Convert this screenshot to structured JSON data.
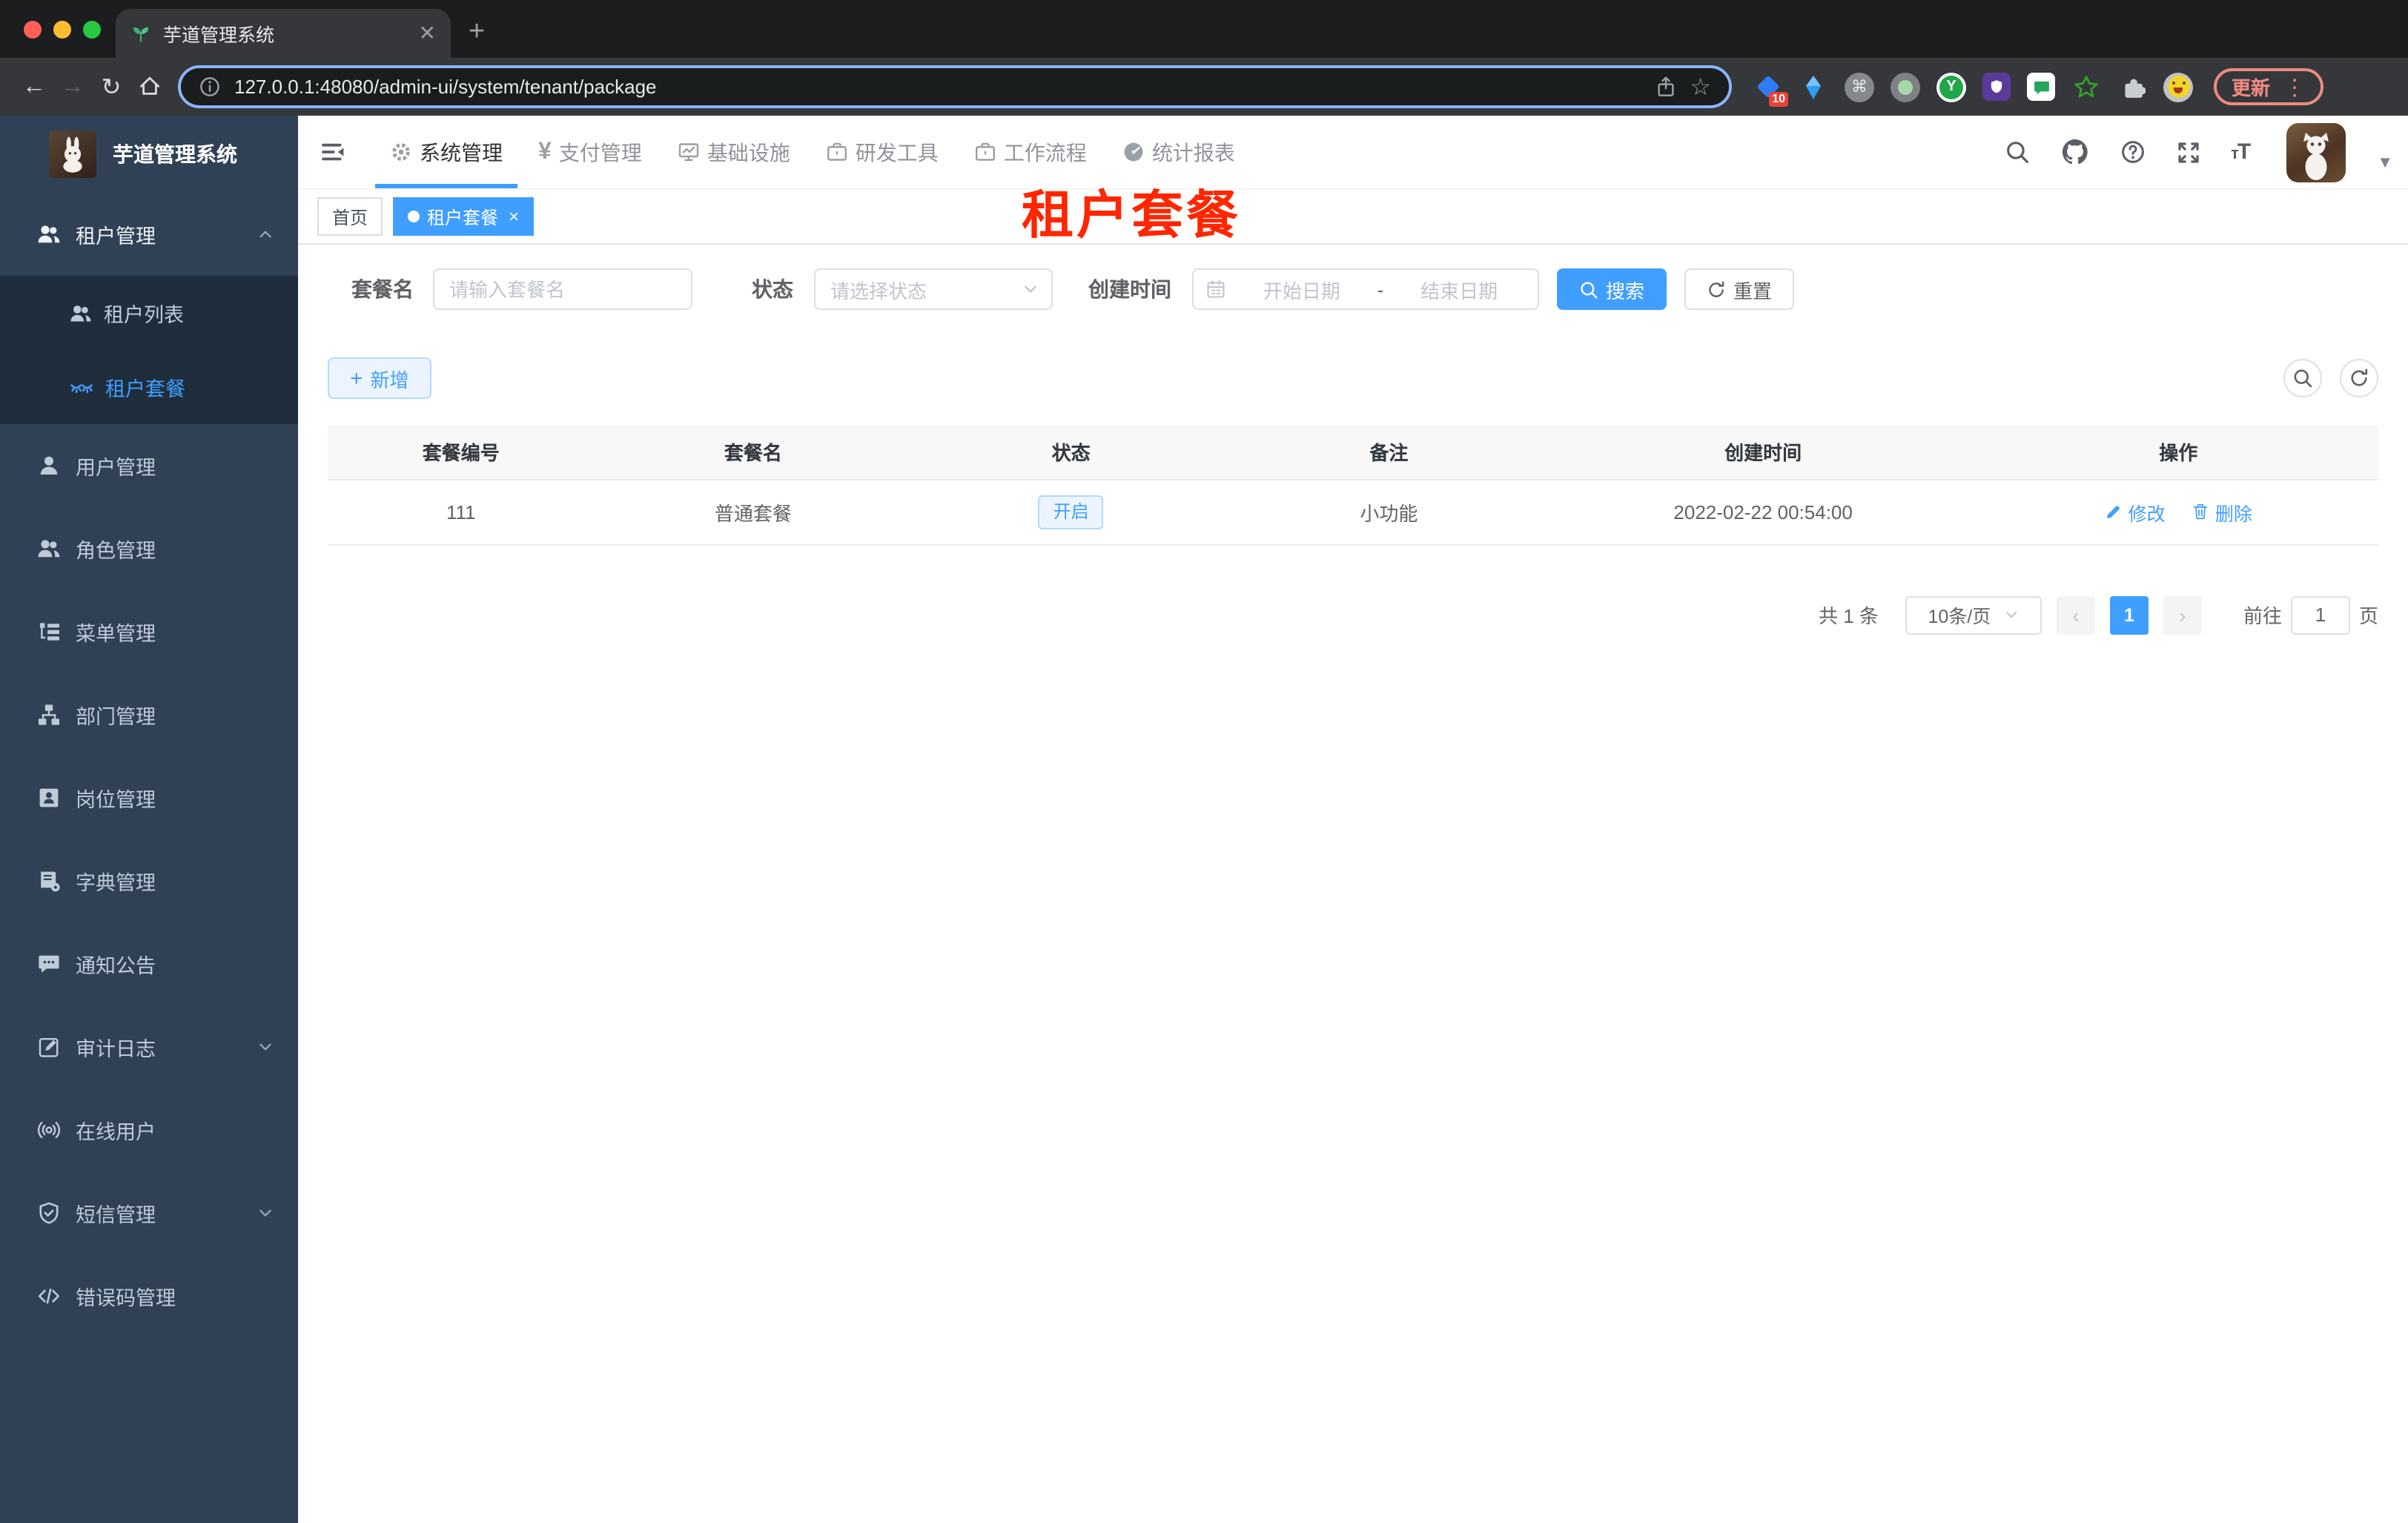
{
  "browser": {
    "tab": {
      "title": "芋道管理系统",
      "favicon": "seedling-icon",
      "close_icon": "close-icon"
    },
    "new_tab_icon": "plus-icon",
    "url": "127.0.0.1:48080/admin-ui/system/tenant/package",
    "toolbar_icons": [
      "back-icon",
      "forward-icon",
      "reload-icon",
      "home-icon",
      "info-icon",
      "share-icon",
      "star-icon"
    ],
    "extension_icons": [
      "diamond-extension-icon",
      "kite-extension-icon",
      "command-extension-icon",
      "record-extension-icon",
      "y-extension-icon",
      "shield-extension-icon",
      "chat-extension-icon",
      "star-extension-icon",
      "puzzle-extensions-icon",
      "emoji-avatar-icon"
    ],
    "extensions_badge": "10",
    "update_label": "更新",
    "menu_icon": "kebab-menu-icon"
  },
  "app": {
    "logo_title": "芋道管理系统",
    "overlay_text": "租户套餐",
    "top_nav": {
      "items": [
        {
          "label": "系统管理",
          "icon": "gear-icon",
          "active": true
        },
        {
          "label": "支付管理",
          "icon": "yen-icon",
          "active": false
        },
        {
          "label": "基础设施",
          "icon": "monitor-icon",
          "active": false
        },
        {
          "label": "研发工具",
          "icon": "toolbox-icon",
          "active": false
        },
        {
          "label": "工作流程",
          "icon": "workflow-icon",
          "active": false
        },
        {
          "label": "统计报表",
          "icon": "dashboard-icon",
          "active": false
        }
      ]
    },
    "header_icons": [
      "search-icon",
      "github-icon",
      "question-icon",
      "fullscreen-icon",
      "font-size-icon",
      "avatar",
      "caret-down-icon"
    ],
    "sidebar": {
      "items": [
        {
          "label": "租户管理",
          "icon": "users-icon",
          "state": "expanded"
        },
        {
          "label": "租户列表",
          "icon": "tenant-list-icon",
          "child": true
        },
        {
          "label": "租户套餐",
          "icon": "peoples-icon",
          "child": true,
          "active": true
        },
        {
          "label": "用户管理",
          "icon": "user-icon"
        },
        {
          "label": "角色管理",
          "icon": "role-users-icon"
        },
        {
          "label": "菜单管理",
          "icon": "menu-tree-icon"
        },
        {
          "label": "部门管理",
          "icon": "dept-tree-icon"
        },
        {
          "label": "岗位管理",
          "icon": "post-badge-icon"
        },
        {
          "label": "字典管理",
          "icon": "dict-book-icon"
        },
        {
          "label": "通知公告",
          "icon": "message-icon"
        },
        {
          "label": "审计日志",
          "icon": "log-edit-icon",
          "state": "collapsed"
        },
        {
          "label": "在线用户",
          "icon": "online-broadcast-icon"
        },
        {
          "label": "短信管理",
          "icon": "sms-shield-icon",
          "state": "collapsed"
        },
        {
          "label": "错误码管理",
          "icon": "code-icon"
        }
      ]
    },
    "tags": {
      "home": "首页",
      "active": "租户套餐"
    },
    "filters": {
      "name_label": "套餐名",
      "name_placeholder": "请输入套餐名",
      "status_label": "状态",
      "status_placeholder": "请选择状态",
      "date_label": "创建时间",
      "date_start_placeholder": "开始日期",
      "date_separator": "-",
      "date_end_placeholder": "结束日期",
      "search_label": "搜索",
      "reset_label": "重置"
    },
    "toolbar": {
      "add_label": "新增"
    },
    "table": {
      "headers": [
        "套餐编号",
        "套餐名",
        "状态",
        "备注",
        "创建时间",
        "操作"
      ],
      "rows": [
        {
          "id": "111",
          "name": "普通套餐",
          "status": "开启",
          "remark": "小功能",
          "created": "2022-02-22 00:54:00",
          "edit": "修改",
          "delete": "删除"
        }
      ]
    },
    "pagination": {
      "total": "共 1 条",
      "page_size": "10条/页",
      "prev_icon": "chevron-left-icon",
      "page": "1",
      "next_icon": "chevron-right-icon",
      "goto_label": "前往",
      "goto_value": "1",
      "page_unit": "页"
    }
  },
  "colors": {
    "primary": "#409EFF",
    "sidebar_bg": "#304156",
    "submenu_bg": "#1F2D3D",
    "annotation_red": "#FF2600"
  }
}
